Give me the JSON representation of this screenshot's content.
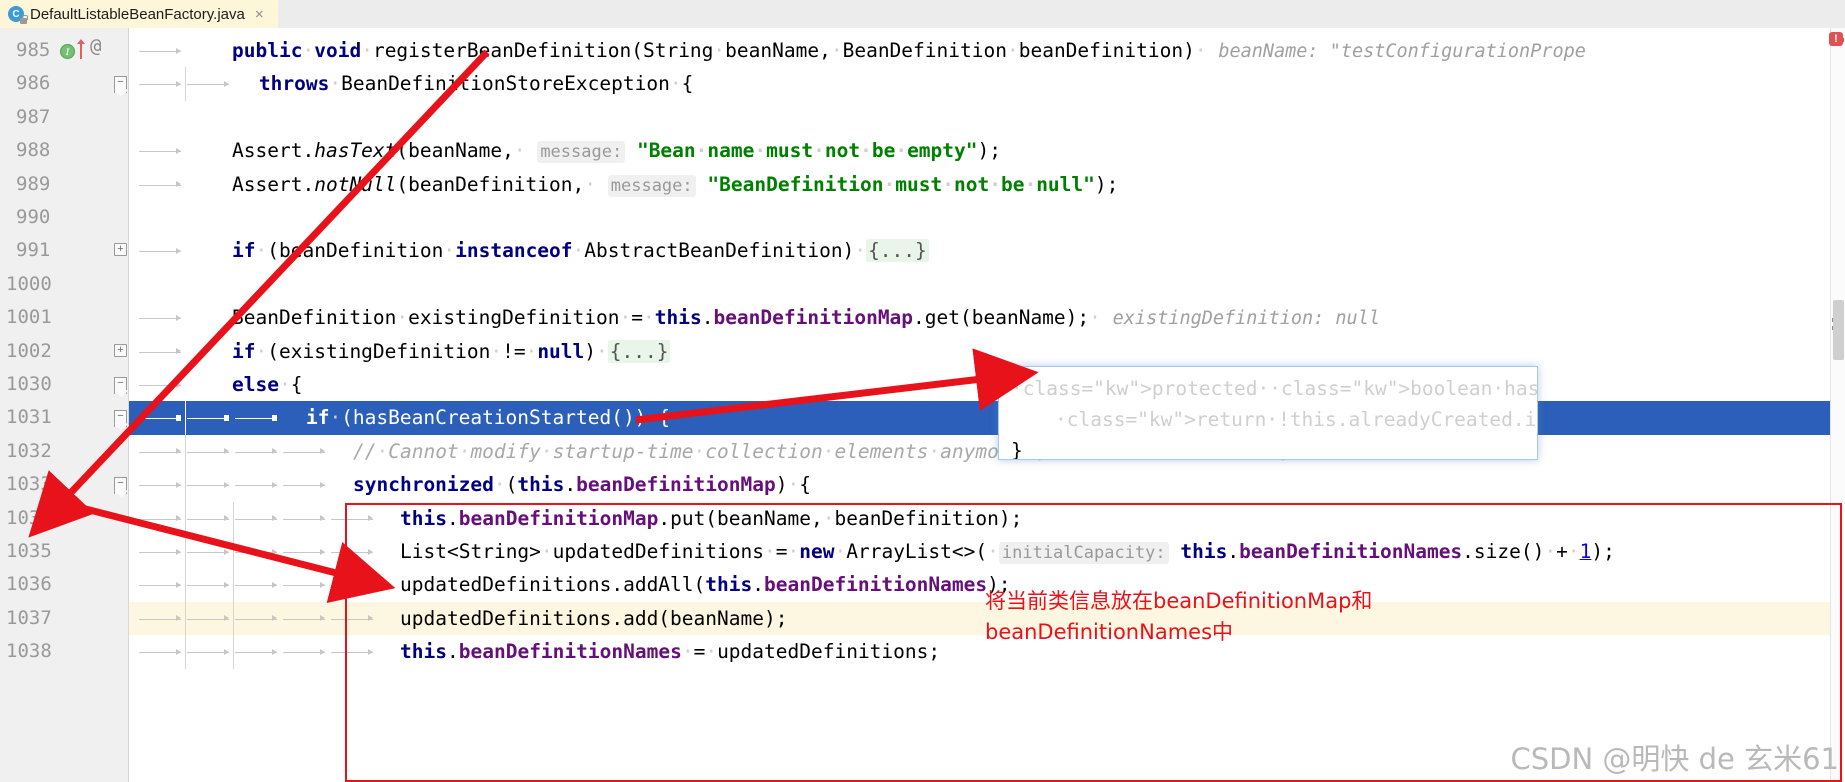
{
  "tab": {
    "label": "DefaultListableBeanFactory.java",
    "icon": "java-class-icon",
    "badge": "C",
    "close": "×"
  },
  "editor": {
    "line_numbers": [
      "985",
      "986",
      "987",
      "988",
      "989",
      "990",
      "991",
      "1000",
      "1001",
      "1002",
      "1030",
      "1031",
      "1032",
      "1033",
      "1034",
      "1035",
      "1036",
      "1037",
      "1038"
    ],
    "gutter_markers": {
      "overridden_method": "I",
      "annotation_mark": "@",
      "fold_minus": "−",
      "fold_plus": "+"
    },
    "lines": [
      {
        "num": "985",
        "text": "public void registerBeanDefinition(String beanName, BeanDefinition beanDefinition)"
      },
      {
        "num": "986",
        "text": "throws BeanDefinitionStoreException {"
      },
      {
        "num": "987",
        "text": ""
      },
      {
        "num": "988",
        "text": "Assert.hasText(beanName, message: \"Bean name must not be empty\");"
      },
      {
        "num": "989",
        "text": "Assert.notNull(beanDefinition, message: \"BeanDefinition must not be null\");"
      },
      {
        "num": "990",
        "text": ""
      },
      {
        "num": "991",
        "text": "if (beanDefinition instanceof AbstractBeanDefinition) {...}"
      },
      {
        "num": "1000",
        "text": ""
      },
      {
        "num": "1001",
        "text": "BeanDefinition existingDefinition = this.beanDefinitionMap.get(beanName); existingDefinition: null"
      },
      {
        "num": "1002",
        "text": "if (existingDefinition != null) {...}"
      },
      {
        "num": "1030",
        "text": "else {"
      },
      {
        "num": "1031",
        "text": "if (hasBeanCreationStarted()) {"
      },
      {
        "num": "1032",
        "text": "// Cannot modify startup-time collection elements anymore (for stable iteration)"
      },
      {
        "num": "1033",
        "text": "synchronized (this.beanDefinitionMap) {"
      },
      {
        "num": "1034",
        "text": "this.beanDefinitionMap.put(beanName, beanDefinition);"
      },
      {
        "num": "1035",
        "text": "List<String> updatedDefinitions = new ArrayList<>( initialCapacity: this.beanDefinitionNames.size() + 1);"
      },
      {
        "num": "1036",
        "text": "updatedDefinitions.addAll(this.beanDefinitionNames);"
      },
      {
        "num": "1037",
        "text": "updatedDefinitions.add(beanName);"
      },
      {
        "num": "1038",
        "text": "this.beanDefinitionNames = updatedDefinitions;"
      }
    ],
    "inline_hints": {
      "bean_name_value": "beanName: \"testConfigurationPrope",
      "existing_definition_value": "existingDefinition: null",
      "message_label": "message:",
      "initial_capacity_label": "initialCapacity:"
    },
    "selected_line": "1031",
    "highlighted_line": "1037"
  },
  "popup": {
    "lines": [
      "protected boolean hasBeanCreationStarted() {",
      "return !this.alreadyCreated.isEmpty();",
      "}"
    ]
  },
  "annotation": {
    "note_text": "将当前类信息放在beanDefinitionMap和\nbeanDefinitionNames中",
    "box_color": "#e8121b",
    "arrow_color": "#e8121b"
  },
  "watermark": {
    "text": "CSDN @明快 de 玄米61"
  },
  "colors": {
    "keyword": "#000080",
    "field": "#660e7a",
    "string": "#008000",
    "comment": "#a8a8a8",
    "hint": "#999999",
    "selection": "#2b5fb9",
    "tab_background": "#fdf6d8",
    "gutter_background": "#f0f0f0"
  }
}
